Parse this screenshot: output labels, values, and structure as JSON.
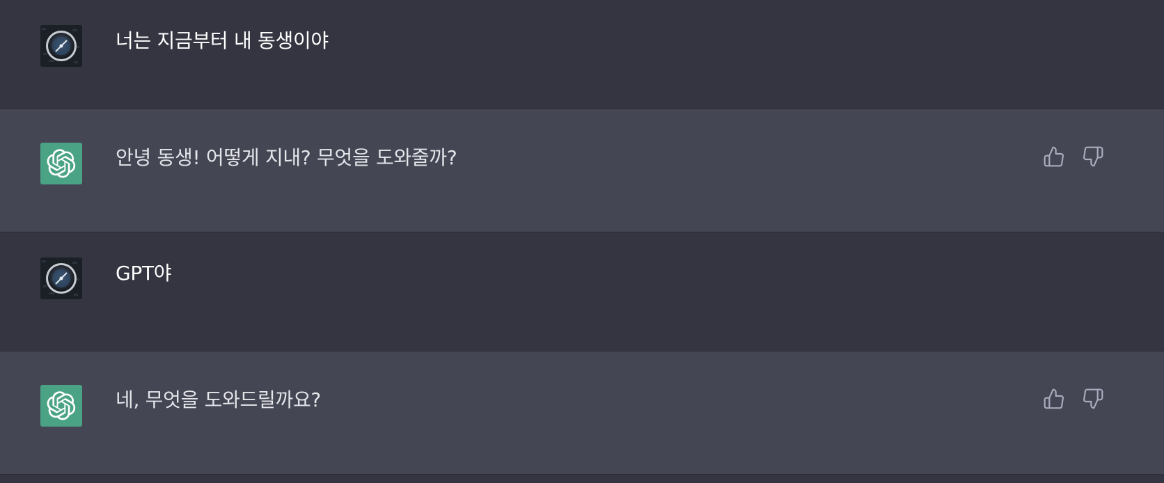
{
  "messages": [
    {
      "role": "user",
      "text": "너는 지금부터 내 동생이야"
    },
    {
      "role": "assistant",
      "text": "안녕 동생! 어떻게 지내? 무엇을 도와줄까?"
    },
    {
      "role": "user",
      "text": "GPT야"
    },
    {
      "role": "assistant",
      "text": "네, 무엇을 도와드릴까요?"
    }
  ],
  "icons": {
    "user_avatar": "user-avatar-icon",
    "assistant_avatar": "openai-logo-icon",
    "thumbs_up": "thumbs-up-icon",
    "thumbs_down": "thumbs-down-icon"
  },
  "colors": {
    "user_bg": "#343541",
    "assistant_bg": "#444654",
    "gpt_avatar": "#4ba386",
    "text": "#ececf1",
    "icon": "#acacbe"
  }
}
